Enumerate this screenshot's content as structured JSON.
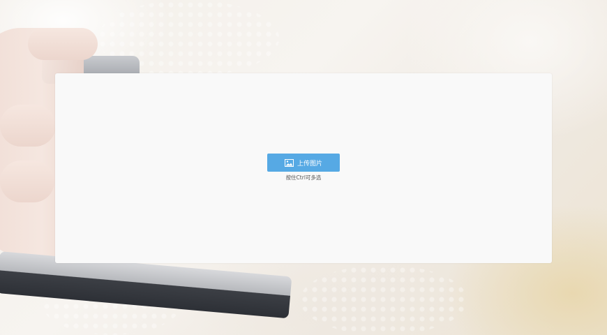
{
  "upload": {
    "button_label": "上传图片",
    "icon": "image-icon",
    "hint": "按住Ctrl可多选"
  },
  "colors": {
    "accent": "#56a9e4",
    "panel_bg": "#f9f9f9",
    "hint_text": "#555555"
  }
}
